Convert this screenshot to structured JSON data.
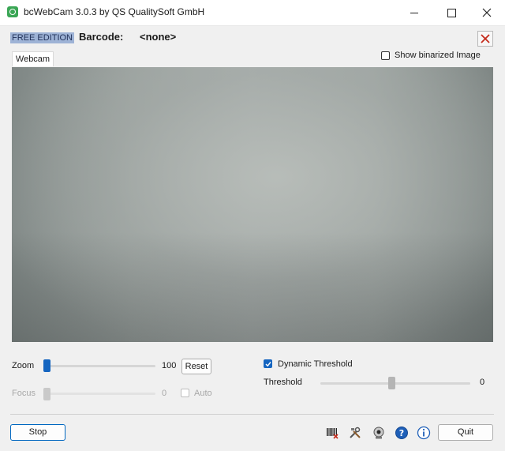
{
  "window": {
    "title": "bcWebCam 3.0.3 by QS QualitySoft GmbH",
    "app_icon": "webcam-app-icon"
  },
  "header": {
    "edition": "FREE EDITION",
    "barcode_label": "Barcode:",
    "barcode_value": "<none>"
  },
  "tabs": [
    {
      "label": "Webcam",
      "active": true
    }
  ],
  "options": {
    "show_binarized_label": "Show binarized Image",
    "show_binarized_checked": false
  },
  "controls": {
    "zoom": {
      "label": "Zoom",
      "value": "100",
      "reset_label": "Reset",
      "level": 0
    },
    "focus": {
      "label": "Focus",
      "value": "0",
      "auto_label": "Auto",
      "enabled": false,
      "level": 0
    },
    "dynamic_threshold": {
      "label": "Dynamic Threshold",
      "checked": true
    },
    "threshold": {
      "label": "Threshold",
      "value": "0",
      "level": 0.47
    }
  },
  "footer": {
    "stop_label": "Stop",
    "quit_label": "Quit",
    "icons": [
      "barcode-icon",
      "tools-icon",
      "webcam-icon",
      "help-icon",
      "info-icon"
    ]
  },
  "colors": {
    "accent": "#1565c0",
    "edition_bg": "#9eb3d6",
    "close_red": "#c42b1c"
  }
}
